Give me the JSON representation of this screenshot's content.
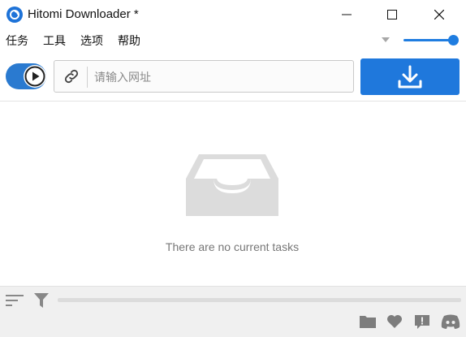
{
  "window": {
    "title": "Hitomi Downloader *",
    "minimize_icon": "minimize-icon",
    "maximize_icon": "maximize-icon",
    "close_icon": "close-icon"
  },
  "menu": {
    "items": [
      {
        "label": "任务"
      },
      {
        "label": "工具"
      },
      {
        "label": "选项"
      },
      {
        "label": "帮助"
      }
    ]
  },
  "volume_slider": {
    "value_fraction": 1.0,
    "color": "#1f7de0"
  },
  "toolbar": {
    "toggle_on": true,
    "toggle_color": "#2a7ad0",
    "url_placeholder": "请输入网址",
    "url_value": "",
    "download_color": "#1f78dc"
  },
  "main": {
    "empty_message": "There are no current tasks"
  },
  "footer": {
    "icons": [
      "folder-icon",
      "heart-icon",
      "feedback-icon",
      "discord-icon"
    ]
  }
}
